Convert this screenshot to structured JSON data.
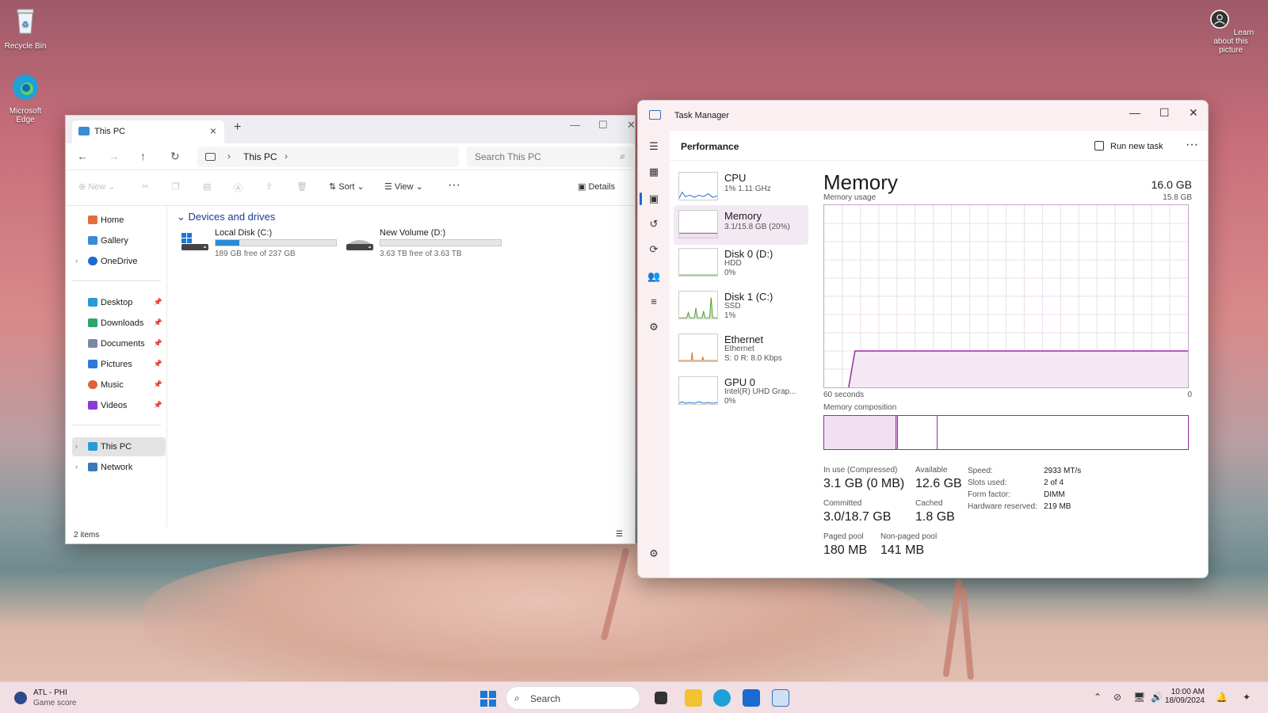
{
  "desktop": {
    "icons": [
      {
        "label": "Recycle Bin"
      },
      {
        "label": "Microsoft Edge"
      }
    ],
    "learn_about": "Learn about this picture"
  },
  "explorer": {
    "tab_title": "This PC",
    "breadcrumb": "This PC",
    "search_placeholder": "Search This PC",
    "commands": {
      "new": "New",
      "sort": "Sort",
      "view": "View",
      "details": "Details"
    },
    "nav": {
      "home": "Home",
      "gallery": "Gallery",
      "onedrive": "OneDrive",
      "desktop": "Desktop",
      "downloads": "Downloads",
      "documents": "Documents",
      "pictures": "Pictures",
      "music": "Music",
      "videos": "Videos",
      "this_pc": "This PC",
      "network": "Network"
    },
    "section": "Devices and drives",
    "drives": [
      {
        "name": "Local Disk (C:)",
        "free": "189 GB free of 237 GB",
        "used_fraction": 0.2
      },
      {
        "name": "New Volume (D:)",
        "free": "3.63 TB free of 3.63 TB",
        "used_fraction": 0.0
      }
    ],
    "status": "2 items"
  },
  "taskmgr": {
    "title": "Task Manager",
    "page": "Performance",
    "run_new_task": "Run new task",
    "items": [
      {
        "name": "CPU",
        "sub1": "1% 1.11 GHz",
        "sub2": ""
      },
      {
        "name": "Memory",
        "sub1": "3.1/15.8 GB (20%)",
        "sub2": ""
      },
      {
        "name": "Disk 0 (D:)",
        "sub1": "HDD",
        "sub2": "0%"
      },
      {
        "name": "Disk 1 (C:)",
        "sub1": "SSD",
        "sub2": "1%"
      },
      {
        "name": "Ethernet",
        "sub1": "Ethernet",
        "sub2": "S: 0 R: 8.0 Kbps"
      },
      {
        "name": "GPU 0",
        "sub1": "Intel(R) UHD Grap...",
        "sub2": "0%"
      }
    ],
    "memory": {
      "title": "Memory",
      "total": "16.0 GB",
      "usage_label": "Memory usage",
      "max_label": "15.8 GB",
      "x_left": "60 seconds",
      "x_right": "0",
      "usage_fraction": 0.2,
      "composition_label": "Memory composition",
      "stats": [
        {
          "label": "In use (Compressed)",
          "value": "3.1 GB (0 MB)"
        },
        {
          "label": "Available",
          "value": "12.6 GB"
        },
        {
          "label": "Committed",
          "value": "3.0/18.7 GB"
        },
        {
          "label": "Cached",
          "value": "1.8 GB"
        },
        {
          "label": "Paged pool",
          "value": "180 MB"
        },
        {
          "label": "Non-paged pool",
          "value": "141 MB"
        }
      ],
      "specs": [
        {
          "key": "Speed:",
          "value": "2933 MT/s"
        },
        {
          "key": "Slots used:",
          "value": "2 of 4"
        },
        {
          "key": "Form factor:",
          "value": "DIMM"
        },
        {
          "key": "Hardware reserved:",
          "value": "219 MB"
        }
      ]
    }
  },
  "taskbar": {
    "score_title": "ATL - PHI",
    "score_sub": "Game score",
    "search": "Search",
    "time": "10:00 AM",
    "date": "18/09/2024"
  },
  "colors": {
    "accent": "#1a78d6",
    "memory": "#9a2aa6"
  }
}
